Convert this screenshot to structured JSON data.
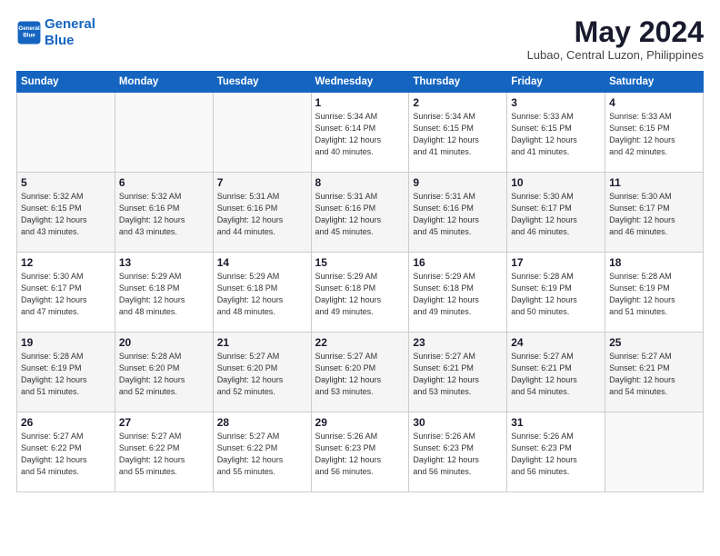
{
  "header": {
    "logo_line1": "General",
    "logo_line2": "Blue",
    "month": "May 2024",
    "location": "Lubao, Central Luzon, Philippines"
  },
  "weekdays": [
    "Sunday",
    "Monday",
    "Tuesday",
    "Wednesday",
    "Thursday",
    "Friday",
    "Saturday"
  ],
  "weeks": [
    [
      {
        "day": "",
        "info": ""
      },
      {
        "day": "",
        "info": ""
      },
      {
        "day": "",
        "info": ""
      },
      {
        "day": "1",
        "info": "Sunrise: 5:34 AM\nSunset: 6:14 PM\nDaylight: 12 hours\nand 40 minutes."
      },
      {
        "day": "2",
        "info": "Sunrise: 5:34 AM\nSunset: 6:15 PM\nDaylight: 12 hours\nand 41 minutes."
      },
      {
        "day": "3",
        "info": "Sunrise: 5:33 AM\nSunset: 6:15 PM\nDaylight: 12 hours\nand 41 minutes."
      },
      {
        "day": "4",
        "info": "Sunrise: 5:33 AM\nSunset: 6:15 PM\nDaylight: 12 hours\nand 42 minutes."
      }
    ],
    [
      {
        "day": "5",
        "info": "Sunrise: 5:32 AM\nSunset: 6:15 PM\nDaylight: 12 hours\nand 43 minutes."
      },
      {
        "day": "6",
        "info": "Sunrise: 5:32 AM\nSunset: 6:16 PM\nDaylight: 12 hours\nand 43 minutes."
      },
      {
        "day": "7",
        "info": "Sunrise: 5:31 AM\nSunset: 6:16 PM\nDaylight: 12 hours\nand 44 minutes."
      },
      {
        "day": "8",
        "info": "Sunrise: 5:31 AM\nSunset: 6:16 PM\nDaylight: 12 hours\nand 45 minutes."
      },
      {
        "day": "9",
        "info": "Sunrise: 5:31 AM\nSunset: 6:16 PM\nDaylight: 12 hours\nand 45 minutes."
      },
      {
        "day": "10",
        "info": "Sunrise: 5:30 AM\nSunset: 6:17 PM\nDaylight: 12 hours\nand 46 minutes."
      },
      {
        "day": "11",
        "info": "Sunrise: 5:30 AM\nSunset: 6:17 PM\nDaylight: 12 hours\nand 46 minutes."
      }
    ],
    [
      {
        "day": "12",
        "info": "Sunrise: 5:30 AM\nSunset: 6:17 PM\nDaylight: 12 hours\nand 47 minutes."
      },
      {
        "day": "13",
        "info": "Sunrise: 5:29 AM\nSunset: 6:18 PM\nDaylight: 12 hours\nand 48 minutes."
      },
      {
        "day": "14",
        "info": "Sunrise: 5:29 AM\nSunset: 6:18 PM\nDaylight: 12 hours\nand 48 minutes."
      },
      {
        "day": "15",
        "info": "Sunrise: 5:29 AM\nSunset: 6:18 PM\nDaylight: 12 hours\nand 49 minutes."
      },
      {
        "day": "16",
        "info": "Sunrise: 5:29 AM\nSunset: 6:18 PM\nDaylight: 12 hours\nand 49 minutes."
      },
      {
        "day": "17",
        "info": "Sunrise: 5:28 AM\nSunset: 6:19 PM\nDaylight: 12 hours\nand 50 minutes."
      },
      {
        "day": "18",
        "info": "Sunrise: 5:28 AM\nSunset: 6:19 PM\nDaylight: 12 hours\nand 51 minutes."
      }
    ],
    [
      {
        "day": "19",
        "info": "Sunrise: 5:28 AM\nSunset: 6:19 PM\nDaylight: 12 hours\nand 51 minutes."
      },
      {
        "day": "20",
        "info": "Sunrise: 5:28 AM\nSunset: 6:20 PM\nDaylight: 12 hours\nand 52 minutes."
      },
      {
        "day": "21",
        "info": "Sunrise: 5:27 AM\nSunset: 6:20 PM\nDaylight: 12 hours\nand 52 minutes."
      },
      {
        "day": "22",
        "info": "Sunrise: 5:27 AM\nSunset: 6:20 PM\nDaylight: 12 hours\nand 53 minutes."
      },
      {
        "day": "23",
        "info": "Sunrise: 5:27 AM\nSunset: 6:21 PM\nDaylight: 12 hours\nand 53 minutes."
      },
      {
        "day": "24",
        "info": "Sunrise: 5:27 AM\nSunset: 6:21 PM\nDaylight: 12 hours\nand 54 minutes."
      },
      {
        "day": "25",
        "info": "Sunrise: 5:27 AM\nSunset: 6:21 PM\nDaylight: 12 hours\nand 54 minutes."
      }
    ],
    [
      {
        "day": "26",
        "info": "Sunrise: 5:27 AM\nSunset: 6:22 PM\nDaylight: 12 hours\nand 54 minutes."
      },
      {
        "day": "27",
        "info": "Sunrise: 5:27 AM\nSunset: 6:22 PM\nDaylight: 12 hours\nand 55 minutes."
      },
      {
        "day": "28",
        "info": "Sunrise: 5:27 AM\nSunset: 6:22 PM\nDaylight: 12 hours\nand 55 minutes."
      },
      {
        "day": "29",
        "info": "Sunrise: 5:26 AM\nSunset: 6:23 PM\nDaylight: 12 hours\nand 56 minutes."
      },
      {
        "day": "30",
        "info": "Sunrise: 5:26 AM\nSunset: 6:23 PM\nDaylight: 12 hours\nand 56 minutes."
      },
      {
        "day": "31",
        "info": "Sunrise: 5:26 AM\nSunset: 6:23 PM\nDaylight: 12 hours\nand 56 minutes."
      },
      {
        "day": "",
        "info": ""
      }
    ]
  ]
}
